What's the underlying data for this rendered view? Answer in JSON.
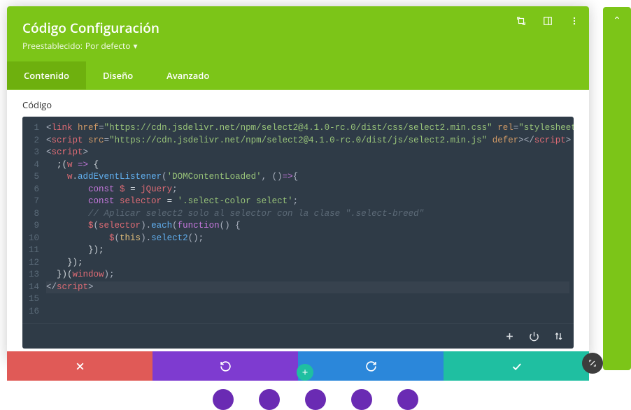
{
  "header": {
    "title": "Código Configuración",
    "preset_label": "Preestablecido:",
    "preset_value": "Por defecto"
  },
  "tabs": [
    {
      "id": "content",
      "label": "Contenido",
      "active": true
    },
    {
      "id": "design",
      "label": "Diseño",
      "active": false
    },
    {
      "id": "advanced",
      "label": "Avanzado",
      "active": false
    }
  ],
  "field": {
    "label": "Código"
  },
  "code_lines": [
    {
      "n": 1,
      "tokens": [
        [
          "punc",
          "<"
        ],
        [
          "tag",
          "link"
        ],
        [
          "plain",
          " "
        ],
        [
          "attr",
          "href"
        ],
        [
          "punc",
          "="
        ],
        [
          "str",
          "\"https://cdn.jsdelivr.net/npm/select2@4.1.0-rc.0/dist/css/select2.min.css\""
        ],
        [
          "plain",
          " "
        ],
        [
          "attr",
          "rel"
        ],
        [
          "punc",
          "="
        ],
        [
          "str",
          "\"stylesheet\""
        ],
        [
          "plain",
          " "
        ],
        [
          "punc",
          "/>"
        ]
      ]
    },
    {
      "n": 2,
      "tokens": [
        [
          "punc",
          "<"
        ],
        [
          "tag",
          "script"
        ],
        [
          "plain",
          " "
        ],
        [
          "attr",
          "src"
        ],
        [
          "punc",
          "="
        ],
        [
          "str",
          "\"https://cdn.jsdelivr.net/npm/select2@4.1.0-rc.0/dist/js/select2.min.js\""
        ],
        [
          "plain",
          " "
        ],
        [
          "attr",
          "defer"
        ],
        [
          "punc",
          "></"
        ],
        [
          "tag",
          "script"
        ],
        [
          "punc",
          ">"
        ]
      ]
    },
    {
      "n": 3,
      "tokens": [
        [
          "plain",
          ""
        ]
      ]
    },
    {
      "n": 4,
      "tokens": [
        [
          "punc",
          "<"
        ],
        [
          "tag",
          "script"
        ],
        [
          "punc",
          ">"
        ]
      ]
    },
    {
      "n": 5,
      "tokens": [
        [
          "plain",
          "  ;("
        ],
        [
          "var",
          "w"
        ],
        [
          "plain",
          " "
        ],
        [
          "kw",
          "=>"
        ],
        [
          "plain",
          " {"
        ]
      ]
    },
    {
      "n": 6,
      "tokens": [
        [
          "plain",
          "    "
        ],
        [
          "var",
          "w"
        ],
        [
          "punc",
          "."
        ],
        [
          "prop",
          "addEventListener"
        ],
        [
          "punc",
          "("
        ],
        [
          "str",
          "'DOMContentLoaded'"
        ],
        [
          "punc",
          ", ()"
        ],
        [
          "kw",
          "=>"
        ],
        [
          "punc",
          "{"
        ]
      ]
    },
    {
      "n": 7,
      "tokens": [
        [
          "plain",
          "        "
        ],
        [
          "kw",
          "const"
        ],
        [
          "plain",
          " "
        ],
        [
          "var",
          "$"
        ],
        [
          "plain",
          " = "
        ],
        [
          "var",
          "jQuery"
        ],
        [
          "punc",
          ";"
        ]
      ]
    },
    {
      "n": 8,
      "tokens": [
        [
          "plain",
          "        "
        ],
        [
          "kw",
          "const"
        ],
        [
          "plain",
          " "
        ],
        [
          "var",
          "selector"
        ],
        [
          "plain",
          " = "
        ],
        [
          "str",
          "'.select-color select'"
        ],
        [
          "punc",
          ";"
        ]
      ]
    },
    {
      "n": 9,
      "tokens": [
        [
          "plain",
          ""
        ]
      ]
    },
    {
      "n": 10,
      "tokens": [
        [
          "plain",
          "        "
        ],
        [
          "comment",
          "// Aplicar select2 solo al selector con la clase \".select-breed\""
        ]
      ]
    },
    {
      "n": 11,
      "tokens": [
        [
          "plain",
          "        "
        ],
        [
          "var",
          "$"
        ],
        [
          "punc",
          "("
        ],
        [
          "var",
          "selector"
        ],
        [
          "punc",
          ")."
        ],
        [
          "prop",
          "each"
        ],
        [
          "punc",
          "("
        ],
        [
          "kw",
          "function"
        ],
        [
          "punc",
          "() {"
        ]
      ]
    },
    {
      "n": 12,
      "tokens": [
        [
          "plain",
          "            "
        ],
        [
          "var",
          "$"
        ],
        [
          "punc",
          "("
        ],
        [
          "this",
          "this"
        ],
        [
          "punc",
          ")."
        ],
        [
          "prop",
          "select2"
        ],
        [
          "punc",
          "();"
        ]
      ]
    },
    {
      "n": 13,
      "tokens": [
        [
          "plain",
          "        });"
        ]
      ]
    },
    {
      "n": 14,
      "tokens": [
        [
          "plain",
          "    });"
        ]
      ]
    },
    {
      "n": 15,
      "tokens": [
        [
          "plain",
          "  })("
        ],
        [
          "var",
          "window"
        ],
        [
          "punc",
          ");"
        ]
      ]
    },
    {
      "n": 16,
      "tokens": [
        [
          "punc",
          "</"
        ],
        [
          "tag",
          "script"
        ],
        [
          "punc",
          ">"
        ]
      ],
      "active": true
    }
  ],
  "icons": {
    "expand": "expand",
    "snap": "snap",
    "menu": "menu",
    "plus": "plus",
    "power": "power",
    "sort": "sort",
    "cancel": "cancel",
    "undo": "undo",
    "redo": "redo",
    "save": "check"
  },
  "colors": {
    "green": "#7cc518",
    "green_dark": "#6eb00e",
    "editor_bg": "#2f3b47",
    "red": "#e05a57",
    "purple": "#7e3bd0",
    "blue": "#2b87da",
    "teal": "#1fbfa1"
  }
}
